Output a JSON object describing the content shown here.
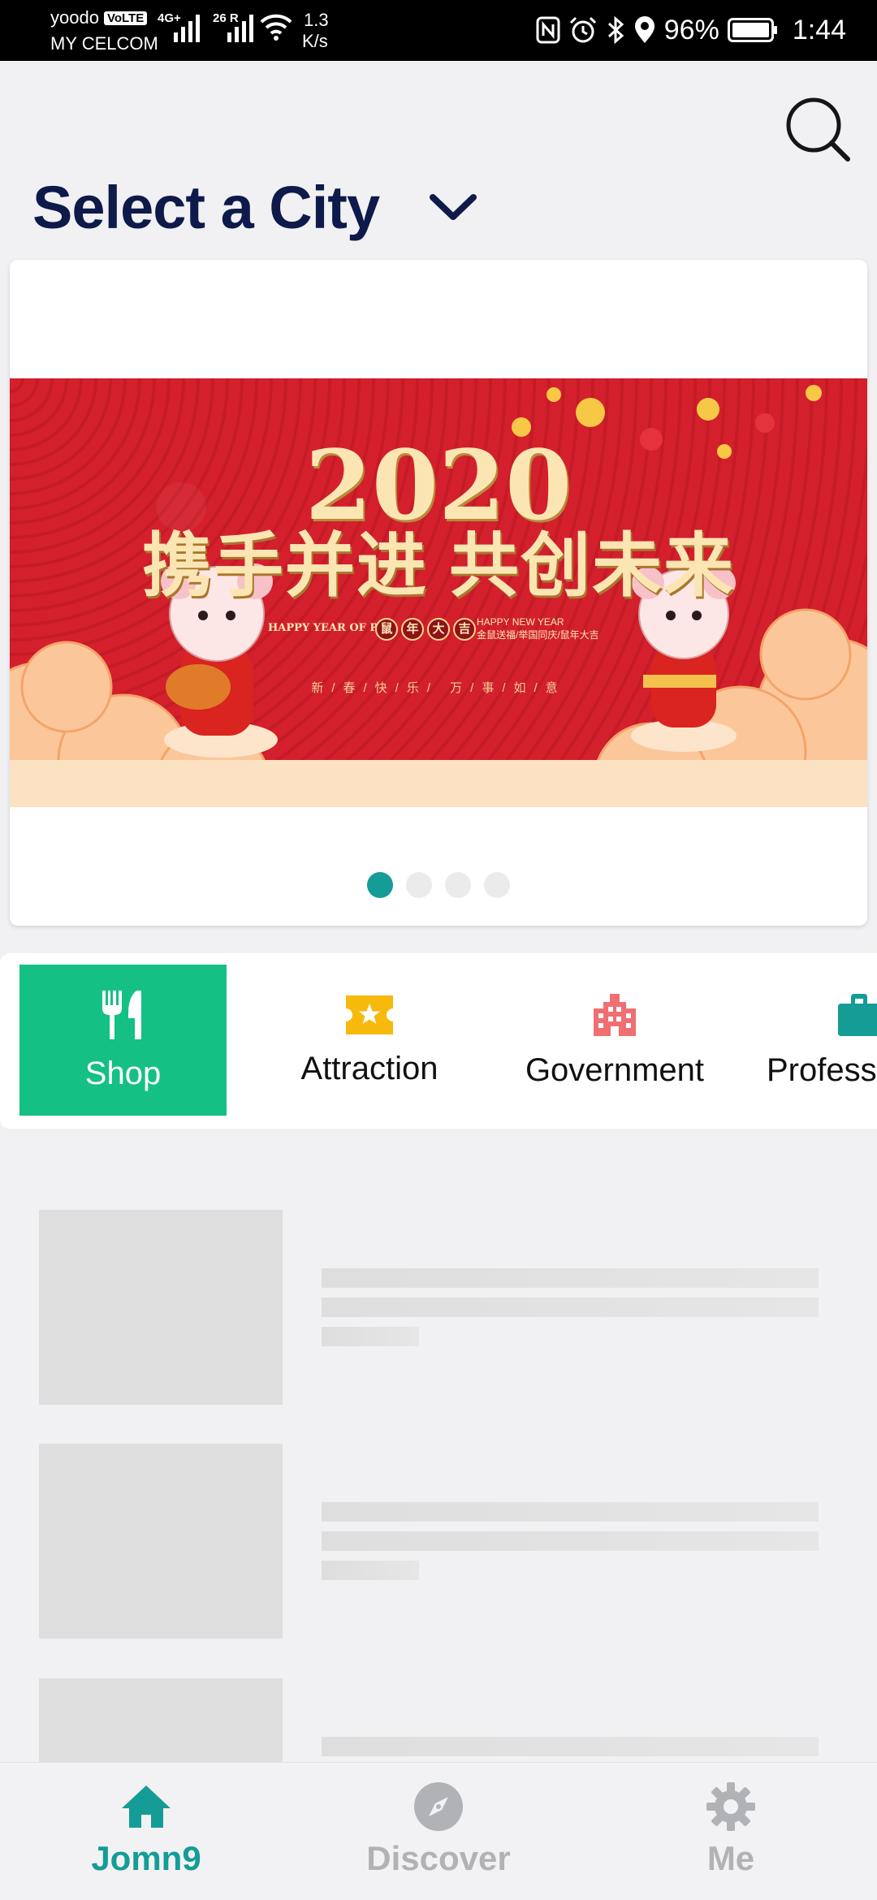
{
  "status_bar": {
    "carrier_line1": "yoodo",
    "volte_badge": "VoLTE",
    "carrier_line2": "MY CELCOM",
    "network1": "4G+",
    "network2": "26 R",
    "speed_value": "1.3",
    "speed_unit": "K/s",
    "battery_percent": "96%",
    "time": "1:44"
  },
  "header": {
    "title": "Select a City",
    "search_icon": "search-icon",
    "dropdown_icon": "chevron-down-icon"
  },
  "banner": {
    "year": "2020",
    "slogan": "携手并进 共创未来",
    "sub_left": "HAPPY YEAR OF PIG",
    "seal_chars": [
      "鼠",
      "年",
      "大",
      "吉"
    ],
    "sub_right_line1": "HAPPY NEW YEAR",
    "sub_right_line2": "金鼠送福/举国同庆/鼠年大吉",
    "small_line": "新/春/快/乐/ 万/事/如/意",
    "slide_count": 4,
    "active_slide": 1,
    "colors": {
      "background": "#d2222d",
      "gold": "#fbe6b3",
      "active_dot": "#159c96"
    }
  },
  "categories": [
    {
      "label": "Shop",
      "icon": "fork-knife-icon",
      "active": true,
      "color": "#ffffff"
    },
    {
      "label": "Attraction",
      "icon": "ticket-star-icon",
      "active": false,
      "color": "#f6b90c"
    },
    {
      "label": "Government",
      "icon": "building-icon",
      "active": false,
      "color": "#ef6f72"
    },
    {
      "label": "Profess",
      "icon": "briefcase-icon",
      "active": false,
      "color": "#159c96"
    }
  ],
  "bottom_nav": [
    {
      "label": "Jomn9",
      "icon": "home-icon",
      "active": true
    },
    {
      "label": "Discover",
      "icon": "compass-icon",
      "active": false
    },
    {
      "label": "Me",
      "icon": "gear-icon",
      "active": false
    }
  ],
  "colors": {
    "accent": "#159c96",
    "shop_active": "#14c083",
    "title": "#0d1a4a"
  }
}
